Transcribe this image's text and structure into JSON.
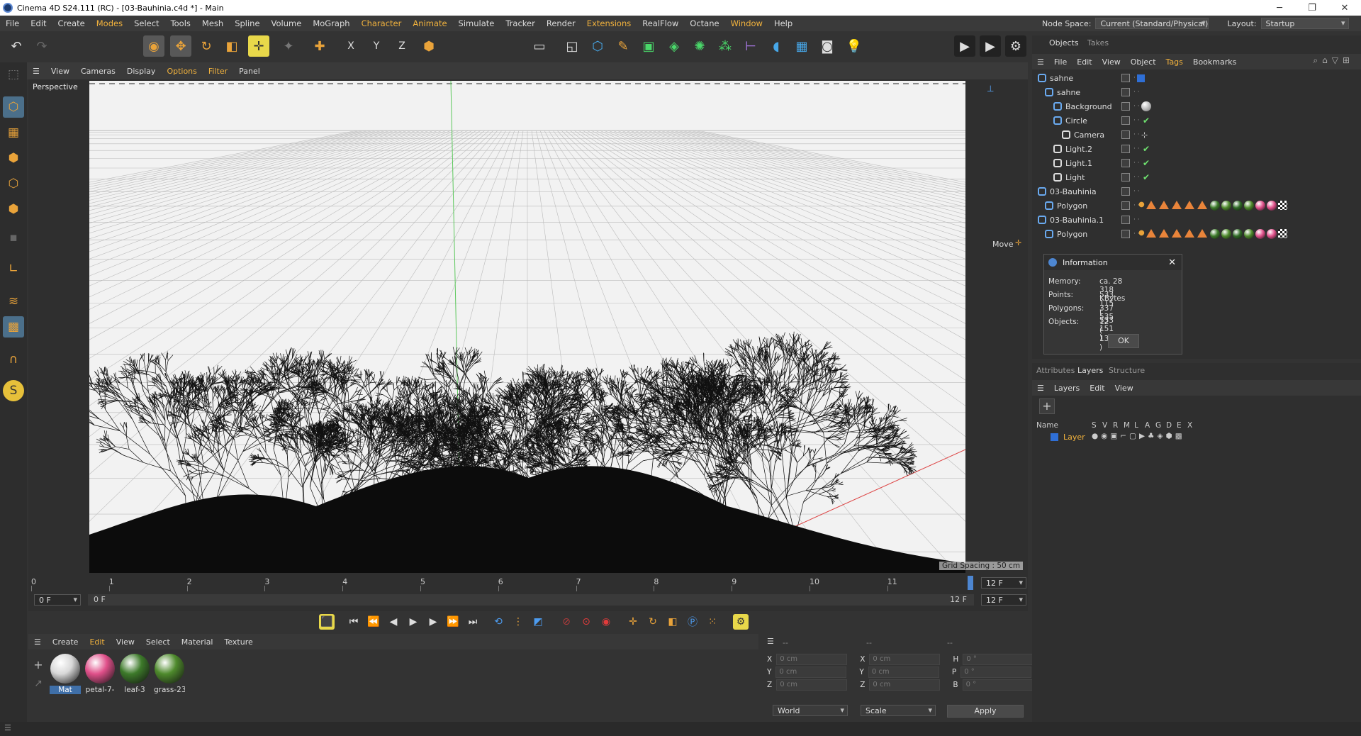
{
  "window": {
    "title": "Cinema 4D S24.111 (RC) - [03-Bauhinia.c4d *] - Main"
  },
  "menubar": {
    "items": [
      "File",
      "Edit",
      "Create",
      "Modes",
      "Select",
      "Tools",
      "Mesh",
      "Spline",
      "Volume",
      "MoGraph",
      "Character",
      "Animate",
      "Simulate",
      "Tracker",
      "Render",
      "Extensions",
      "RealFlow",
      "Octane",
      "Window",
      "Help"
    ],
    "nodespace_label": "Node Space:",
    "nodespace_value": "Current (Standard/Physical)",
    "layout_label": "Layout:",
    "layout_value": "Startup"
  },
  "viewport": {
    "menu": [
      "View",
      "Cameras",
      "Display",
      "Options",
      "Filter",
      "Panel"
    ],
    "camera_label": "Perspective",
    "tool_label": "Move",
    "grid_spacing": "Grid Spacing : 50 cm"
  },
  "timeline": {
    "ticks": [
      "0",
      "1",
      "2",
      "3",
      "4",
      "5",
      "6",
      "7",
      "8",
      "9",
      "10",
      "11"
    ],
    "end_frame": "12 F",
    "start_field": "0 F",
    "range_start": "0 F",
    "range_end": "12 F",
    "max_field": "12 F"
  },
  "materials": {
    "menu": [
      "Create",
      "Edit",
      "View",
      "Select",
      "Material",
      "Texture"
    ],
    "items": [
      {
        "name": "Mat",
        "color": "#d8d8d8"
      },
      {
        "name": "petal-7-",
        "color": "#e0508a"
      },
      {
        "name": "leaf-3",
        "color": "#3d7a2a"
      },
      {
        "name": "grass-23",
        "color": "#4e8a2c"
      }
    ]
  },
  "coords": {
    "headers": [
      "--",
      "--",
      "--"
    ],
    "rows": [
      {
        "a": "X",
        "av": "0 cm",
        "b": "X",
        "bv": "0 cm",
        "c": "H",
        "cv": "0 °"
      },
      {
        "a": "Y",
        "av": "0 cm",
        "b": "Y",
        "bv": "0 cm",
        "c": "P",
        "cv": "0 °"
      },
      {
        "a": "Z",
        "av": "0 cm",
        "b": "Z",
        "bv": "0 cm",
        "c": "B",
        "cv": "0 °"
      }
    ],
    "space": "World",
    "mode": "Scale",
    "apply": "Apply"
  },
  "objects_panel": {
    "tabs": [
      "Objects",
      "Takes"
    ],
    "menu": [
      "File",
      "Edit",
      "View",
      "Object",
      "Tags",
      "Bookmarks"
    ],
    "rows": [
      {
        "name": "sahne"
      },
      {
        "name": "sahne"
      },
      {
        "name": "Background"
      },
      {
        "name": "Circle"
      },
      {
        "name": "Camera"
      },
      {
        "name": "Light.2"
      },
      {
        "name": "Light.1"
      },
      {
        "name": "Light"
      },
      {
        "name": "03-Bauhinia"
      },
      {
        "name": "Polygon"
      },
      {
        "name": "03-Bauhinia.1"
      },
      {
        "name": "Polygon"
      }
    ]
  },
  "info_dialog": {
    "title": "Information",
    "memory_label": "Memory:",
    "memory": "ca. 28 318 KBytes",
    "points_label": "Points:",
    "points": "533 115 ( 533 151 )",
    "polygons_label": "Polygons:",
    "polygons": "337 535",
    "objects_label": "Objects:",
    "objects": "12 ( 13 )",
    "ok": "OK"
  },
  "layers_panel": {
    "tabs": [
      "Attributes",
      "Layers",
      "Structure"
    ],
    "menu": [
      "Layers",
      "Edit",
      "View"
    ],
    "col_name": "Name",
    "cols": [
      "S",
      "V",
      "R",
      "M",
      "L",
      "A",
      "G",
      "D",
      "E",
      "X"
    ],
    "layer_name": "Layer"
  },
  "colors": {
    "accent": "#f3b33d",
    "selection": "#3f6fa8",
    "layer_blue": "#2f6fd6"
  }
}
